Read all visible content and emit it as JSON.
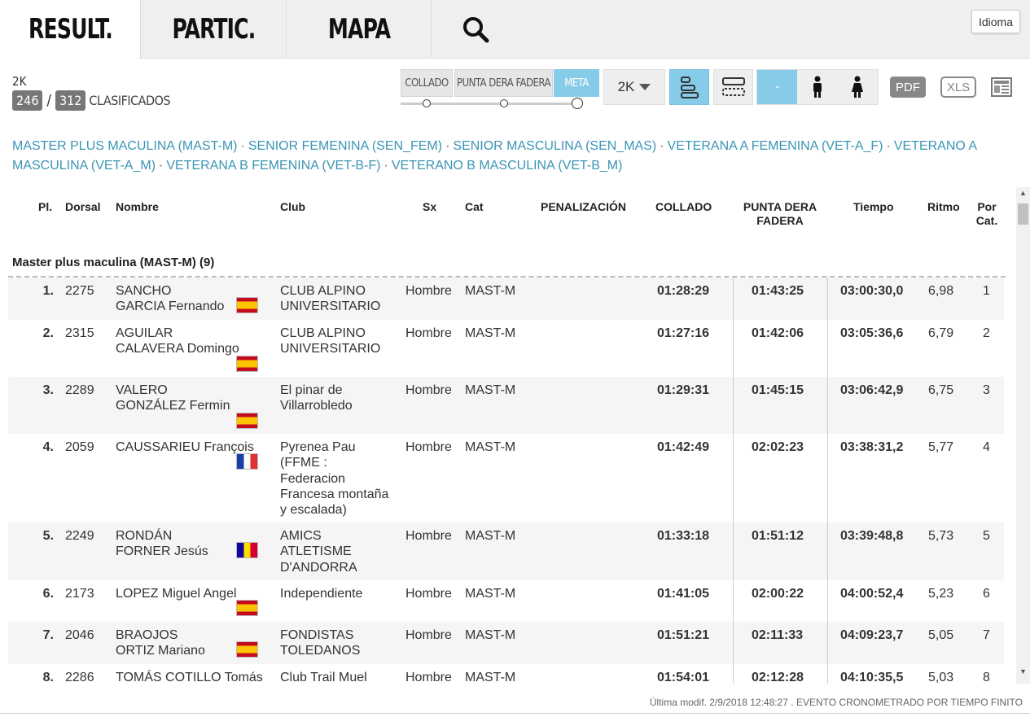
{
  "tabs": [
    {
      "label": "RESULT."
    },
    {
      "label": "PARTIC."
    },
    {
      "label": "MAPA"
    }
  ],
  "idioma_label": "Idioma",
  "race": {
    "distance": "2K",
    "classified": "246",
    "total": "312",
    "sep": "/",
    "classified_label": "CLASIFICADOS"
  },
  "checkpoints": [
    {
      "label": "COLLADO"
    },
    {
      "label": "PUNTA DERA FADERA"
    },
    {
      "label": "META"
    }
  ],
  "distance_select": "2K",
  "sex_filter": {
    "all_label": "-"
  },
  "exports": {
    "pdf": "PDF",
    "xls": "XLS"
  },
  "categories": [
    "MASTER PLUS MACULINA (MAST-M)",
    "SENIOR FEMENINA (SEN_FEM)",
    "SENIOR MASCULINA (SEN_MAS)",
    "VETERANA A FEMENINA (VET-A_F)",
    "VETERANO A MASCULINA (VET-A_M)",
    "VETERANA B FEMENINA (VET-B-F)",
    "VETERANO B MASCULINA (VET-B_M)"
  ],
  "category_separator": "·",
  "table": {
    "headers": {
      "pl": "Pl.",
      "dorsal": "Dorsal",
      "nombre": "Nombre",
      "club": "Club",
      "sx": "Sx",
      "cat": "Cat",
      "penalizacion": "PENALIZACIÓN",
      "collado": "COLLADO",
      "punta_1": "PUNTA DERA",
      "punta_2": "FADERA",
      "tiempo": "Tiempo",
      "ritmo": "Ritmo",
      "porcat_1": "Por",
      "porcat_2": "Cat."
    },
    "group_title": "Master plus maculina (MAST-M) (9)",
    "rows": [
      {
        "pl": "1.",
        "dorsal": "2275",
        "name1": "SANCHO",
        "name2": "GARCIA Fernando",
        "flag": "es",
        "club": [
          "CLUB ALPINO",
          "UNIVERSITARIO"
        ],
        "sx": "Hombre",
        "cat": "MAST-M",
        "collado": "01:28:29",
        "punta": "01:43:25",
        "tiempo": "03:00:30,0",
        "ritmo": "6,98",
        "porcat": "1"
      },
      {
        "pl": "2.",
        "dorsal": "2315",
        "name1": "AGUILAR",
        "name2": "CALAVERA Domingo",
        "flag": "es",
        "club": [
          "CLUB ALPINO",
          "UNIVERSITARIO"
        ],
        "sx": "Hombre",
        "cat": "MAST-M",
        "collado": "01:27:16",
        "punta": "01:42:06",
        "tiempo": "03:05:36,6",
        "ritmo": "6,79",
        "porcat": "2"
      },
      {
        "pl": "3.",
        "dorsal": "2289",
        "name1": "VALERO",
        "name2": "GONZÁLEZ Fermin",
        "flag": "es",
        "club": [
          "El pinar de",
          "Villarrobledo"
        ],
        "sx": "Hombre",
        "cat": "MAST-M",
        "collado": "01:29:31",
        "punta": "01:45:15",
        "tiempo": "03:06:42,9",
        "ritmo": "6,75",
        "porcat": "3"
      },
      {
        "pl": "4.",
        "dorsal": "2059",
        "name1": "CAUSSARIEU François",
        "name2": "",
        "flag": "fr",
        "club": [
          "Pyrenea Pau",
          "(FFME :",
          "Federacion",
          "Francesa montaña",
          "y escalada)"
        ],
        "sx": "Hombre",
        "cat": "MAST-M",
        "collado": "01:42:49",
        "punta": "02:02:23",
        "tiempo": "03:38:31,2",
        "ritmo": "5,77",
        "porcat": "4"
      },
      {
        "pl": "5.",
        "dorsal": "2249",
        "name1": "RONDÁN",
        "name2": "FORNER Jesús",
        "flag": "ad",
        "club": [
          "AMICS",
          "ATLETISME",
          "D'ANDORRA"
        ],
        "sx": "Hombre",
        "cat": "MAST-M",
        "collado": "01:33:18",
        "punta": "01:51:12",
        "tiempo": "03:39:48,8",
        "ritmo": "5,73",
        "porcat": "5"
      },
      {
        "pl": "6.",
        "dorsal": "2173",
        "name1": "LOPEZ Miguel Angel",
        "name2": "",
        "flag": "es",
        "club": [
          "Independiente"
        ],
        "sx": "Hombre",
        "cat": "MAST-M",
        "collado": "01:41:05",
        "punta": "02:00:22",
        "tiempo": "04:00:52,4",
        "ritmo": "5,23",
        "porcat": "6"
      },
      {
        "pl": "7.",
        "dorsal": "2046",
        "name1": "BRAOJOS",
        "name2": "ORTIZ Mariano",
        "flag": "es",
        "club": [
          "FONDISTAS",
          "TOLEDANOS"
        ],
        "sx": "Hombre",
        "cat": "MAST-M",
        "collado": "01:51:21",
        "punta": "02:11:33",
        "tiempo": "04:09:23,7",
        "ritmo": "5,05",
        "porcat": "7"
      },
      {
        "pl": "8.",
        "dorsal": "2286",
        "name1": "TOMÁS COTILLO Tomás",
        "name2": "",
        "flag": "",
        "club": [
          "Club Trail Muel"
        ],
        "sx": "Hombre",
        "cat": "MAST-M",
        "collado": "01:54:01",
        "punta": "02:12:28",
        "tiempo": "04:10:35,5",
        "ritmo": "5,03",
        "porcat": "8"
      }
    ]
  },
  "footer": "Última modif. 2/9/2018 12:48:27 . EVENTO CRONOMETRADO POR TIEMPO FINITO"
}
